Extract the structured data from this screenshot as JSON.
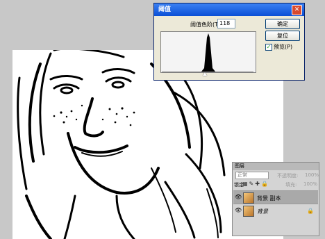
{
  "dialog": {
    "title": "阈值",
    "level_label": "阈值色阶(T):",
    "level_value": "118",
    "ok_label": "确定",
    "reset_label": "复位",
    "preview_label": "预览(P)",
    "preview_checked": true,
    "close_glyph": "✕"
  },
  "layers": {
    "tab_label": "图层",
    "blend_mode": "正常",
    "opacity_label": "不透明度:",
    "opacity_value": "100%",
    "lock_label": "锁定:",
    "fill_label": "填充:",
    "fill_value": "100%",
    "items": [
      {
        "name": "背景 副本",
        "selected": true
      },
      {
        "name": "背景",
        "selected": false,
        "locked": true
      }
    ]
  },
  "colors": {
    "title_bar": "#0a4fd6",
    "workspace": "#c8c8c8"
  }
}
